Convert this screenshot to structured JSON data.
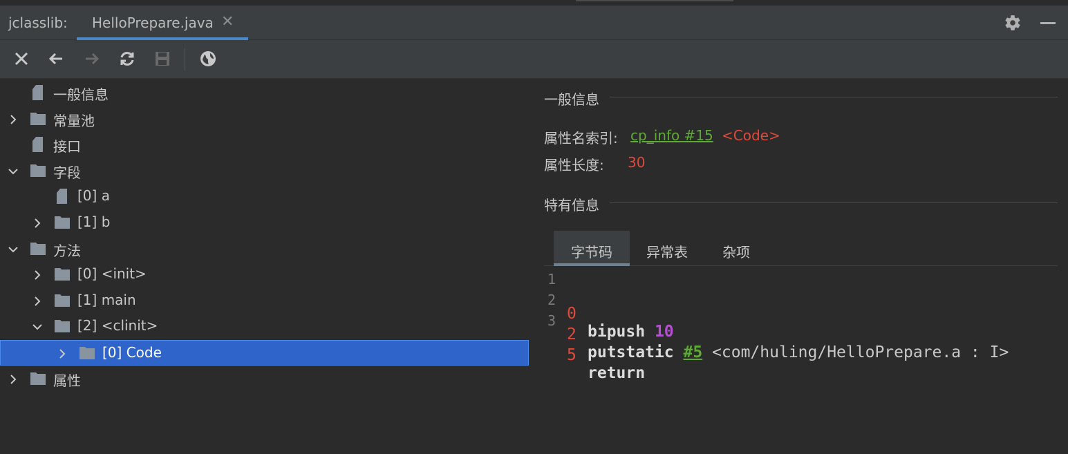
{
  "titlebar": {
    "tool_label": "jclasslib:",
    "tab_label": "HelloPrepare.java",
    "tab_close": "✕"
  },
  "toolbar": {
    "icons": [
      "close-icon",
      "back-icon",
      "forward-icon",
      "refresh-icon",
      "save-icon",
      "web-icon"
    ]
  },
  "tree": {
    "items": [
      {
        "label": "一般信息",
        "icon": "file-icon"
      },
      {
        "label": "常量池",
        "icon": "folder-icon",
        "chevron": "right"
      },
      {
        "label": "接口",
        "icon": "file-icon"
      },
      {
        "label": "字段",
        "icon": "folder-icon",
        "chevron": "down"
      },
      {
        "label": "[0] a",
        "icon": "file-icon"
      },
      {
        "label": "[1] b",
        "icon": "folder-icon",
        "chevron": "right"
      },
      {
        "label": "方法",
        "icon": "folder-icon",
        "chevron": "down"
      },
      {
        "label": "[0] <init>",
        "icon": "folder-icon",
        "chevron": "right"
      },
      {
        "label": "[1] main",
        "icon": "folder-icon",
        "chevron": "right"
      },
      {
        "label": "[2] <clinit>",
        "icon": "folder-icon",
        "chevron": "down"
      },
      {
        "label": "[0] Code",
        "icon": "folder-icon",
        "chevron": "right",
        "selected": true
      },
      {
        "label": "属性",
        "icon": "folder-icon",
        "chevron": "right"
      }
    ]
  },
  "detail": {
    "general_title": "一般信息",
    "attr_name_key": "属性名索引:",
    "attr_name_link": "cp_info #15",
    "attr_name_value": "<Code>",
    "attr_len_key": "属性长度:",
    "attr_len_value": "30",
    "specific_title": "特有信息",
    "tabs": [
      "字节码",
      "异常表",
      "杂项"
    ],
    "active_tab": "字节码"
  },
  "bytecode": [
    {
      "line": "1",
      "offset": "0",
      "op": "bipush",
      "arg": "10"
    },
    {
      "line": "2",
      "offset": "2",
      "op": "putstatic",
      "ref": "#5",
      "desc": "<com/huling/HelloPrepare.a : I>"
    },
    {
      "line": "3",
      "offset": "5",
      "op": "return"
    }
  ],
  "colors": {
    "background": "#2b2b2b",
    "panel": "#3c3f41",
    "selection": "#2f65ca",
    "accent_tab": "#4a88c7",
    "link_green": "#5faa35",
    "value_red": "#e04a3a",
    "number_purple": "#b450d0"
  }
}
